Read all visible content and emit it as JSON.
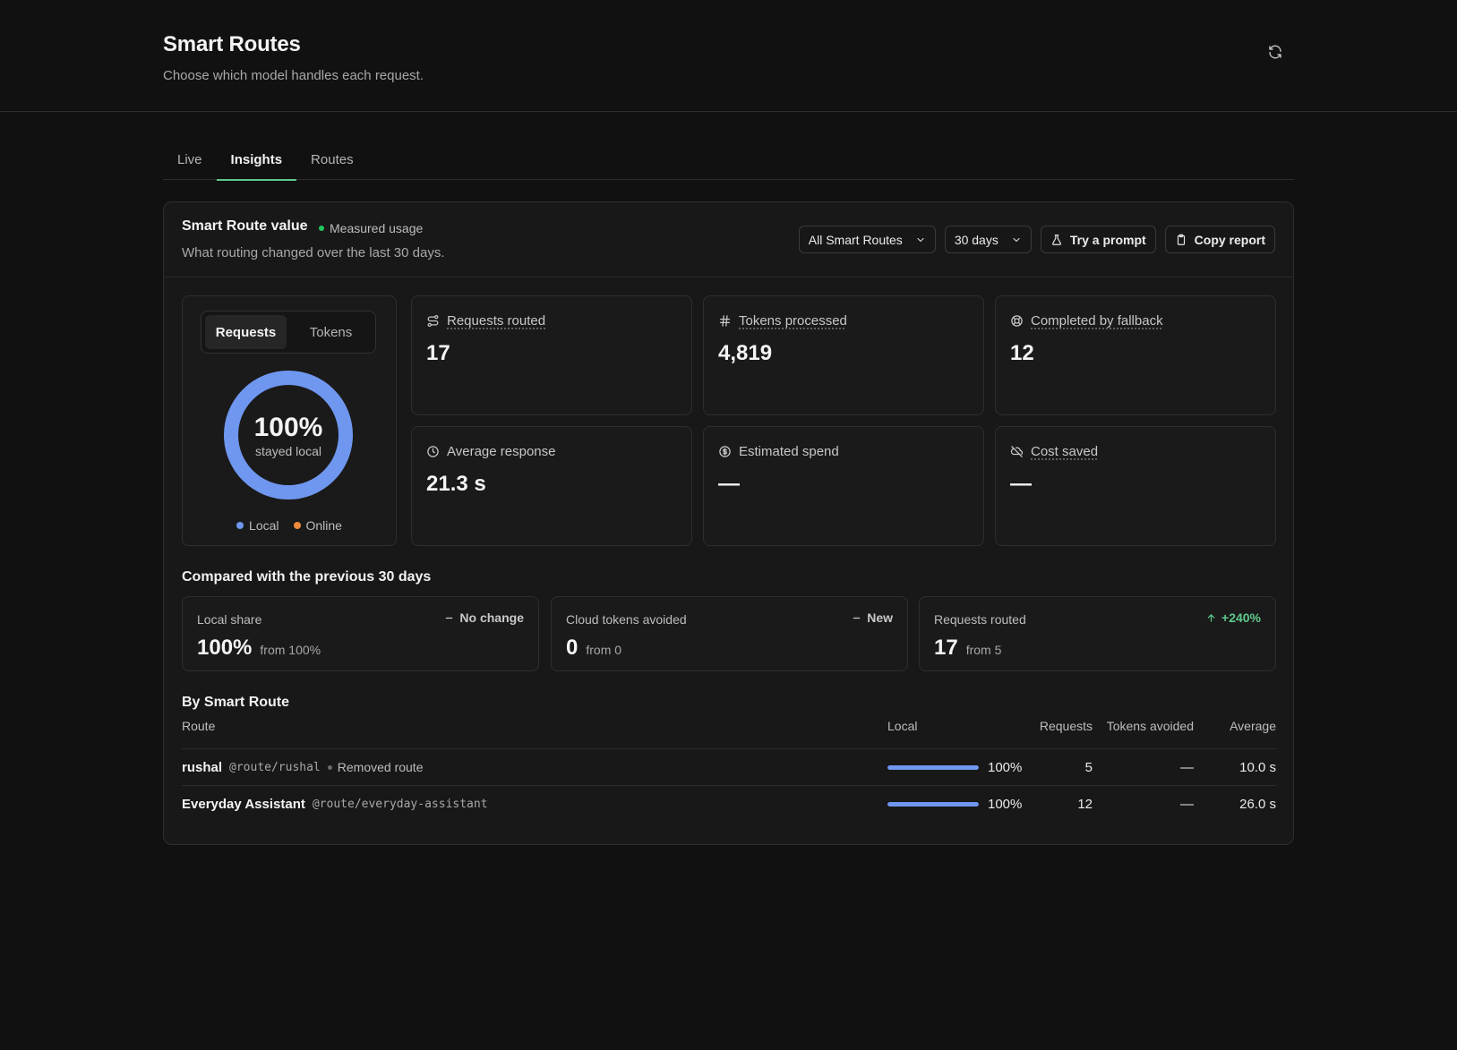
{
  "header": {
    "title": "Smart Routes",
    "subtitle": "Choose which model handles each request.",
    "refresh_icon": "refresh-icon"
  },
  "tabs": [
    {
      "label": "Live",
      "active": false
    },
    {
      "label": "Insights",
      "active": true
    },
    {
      "label": "Routes",
      "active": false
    }
  ],
  "panel": {
    "title": "Smart Route value",
    "status": "Measured usage",
    "status_color": "#22c55e",
    "description": "What routing changed over the last 30 days.",
    "controls": {
      "route_filter": "All Smart Routes",
      "period": "30 days",
      "try_prompt": "Try a prompt",
      "copy_report": "Copy report"
    }
  },
  "donut": {
    "toggle": {
      "requests": "Requests",
      "tokens": "Tokens",
      "selected": "Requests"
    },
    "percent": "100%",
    "caption": "stayed local",
    "local_share": 1.0,
    "legend": [
      {
        "label": "Local",
        "color": "#6f97f0"
      },
      {
        "label": "Online",
        "color": "#f08a3c"
      }
    ]
  },
  "metrics": [
    {
      "label": "Requests routed",
      "value": "17",
      "icon": "route-icon",
      "underlined": true
    },
    {
      "label": "Tokens processed",
      "value": "4,819",
      "icon": "hash-icon",
      "underlined": true
    },
    {
      "label": "Completed by fallback",
      "value": "12",
      "icon": "lifebuoy-icon",
      "underlined": true
    },
    {
      "label": "Average response",
      "value": "21.3 s",
      "icon": "clock-icon",
      "underlined": false
    },
    {
      "label": "Estimated spend",
      "value": "—",
      "icon": "dollar-circle-icon",
      "underlined": false
    },
    {
      "label": "Cost saved",
      "value": "—",
      "icon": "cloud-off-icon",
      "underlined": true
    }
  ],
  "comparison": {
    "title": "Compared with the previous 30 days",
    "cards": [
      {
        "label": "Local share",
        "badge": "No change",
        "badge_icon": "minus-icon",
        "value": "100%",
        "from": "from 100%"
      },
      {
        "label": "Cloud tokens avoided",
        "badge": "New",
        "badge_icon": "minus-icon",
        "value": "0",
        "from": "from 0"
      },
      {
        "label": "Requests routed",
        "badge": "+240%",
        "badge_icon": "arrow-up-icon",
        "value": "17",
        "from": "from 5"
      }
    ]
  },
  "by_route": {
    "title": "By Smart Route",
    "columns": {
      "route": "Route",
      "local": "Local",
      "requests": "Requests",
      "tokens_avoided": "Tokens avoided",
      "average": "Average"
    },
    "rows": [
      {
        "name": "rushal",
        "slug": "@route/rushal",
        "note": "Removed route",
        "local_pct": "100%",
        "local_share": 1.0,
        "requests": "5",
        "tokens_avoided": "—",
        "average": "10.0 s"
      },
      {
        "name": "Everyday Assistant",
        "slug": "@route/everyday-assistant",
        "note": "",
        "local_pct": "100%",
        "local_share": 1.0,
        "requests": "12",
        "tokens_avoided": "—",
        "average": "26.0 s"
      }
    ]
  },
  "colors": {
    "accent_green": "#5ec98d",
    "local_blue": "#6f97f0",
    "online_orange": "#f08a3c"
  }
}
